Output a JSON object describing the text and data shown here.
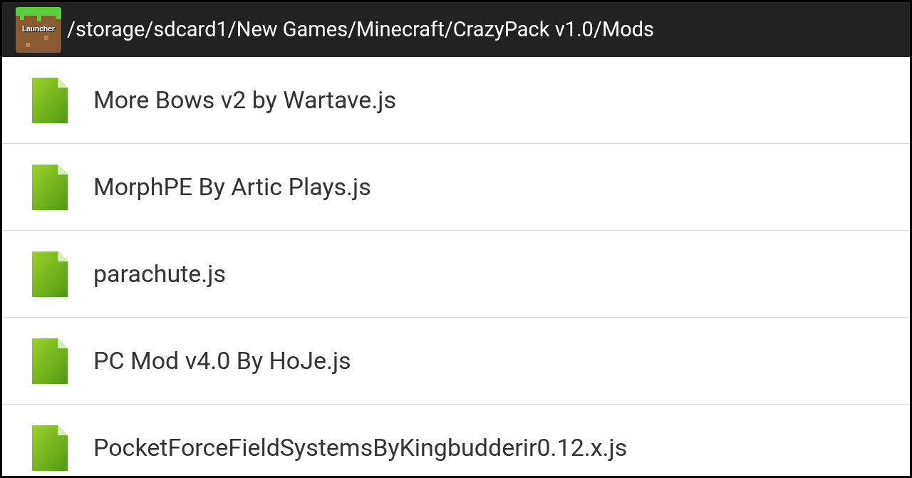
{
  "header": {
    "app_icon_label": "Launcher",
    "path": "/storage/sdcard1/New Games/Minecraft/CrazyPack v1.0/Mods"
  },
  "files": [
    {
      "name": "More Bows v2 by Wartave.js"
    },
    {
      "name": "MorphPE By Artic Plays.js"
    },
    {
      "name": "parachute.js"
    },
    {
      "name": "PC Mod v4.0 By HoJe.js"
    },
    {
      "name": "PocketForceFieldSystemsByKingbudderir0.12.x.js"
    }
  ]
}
